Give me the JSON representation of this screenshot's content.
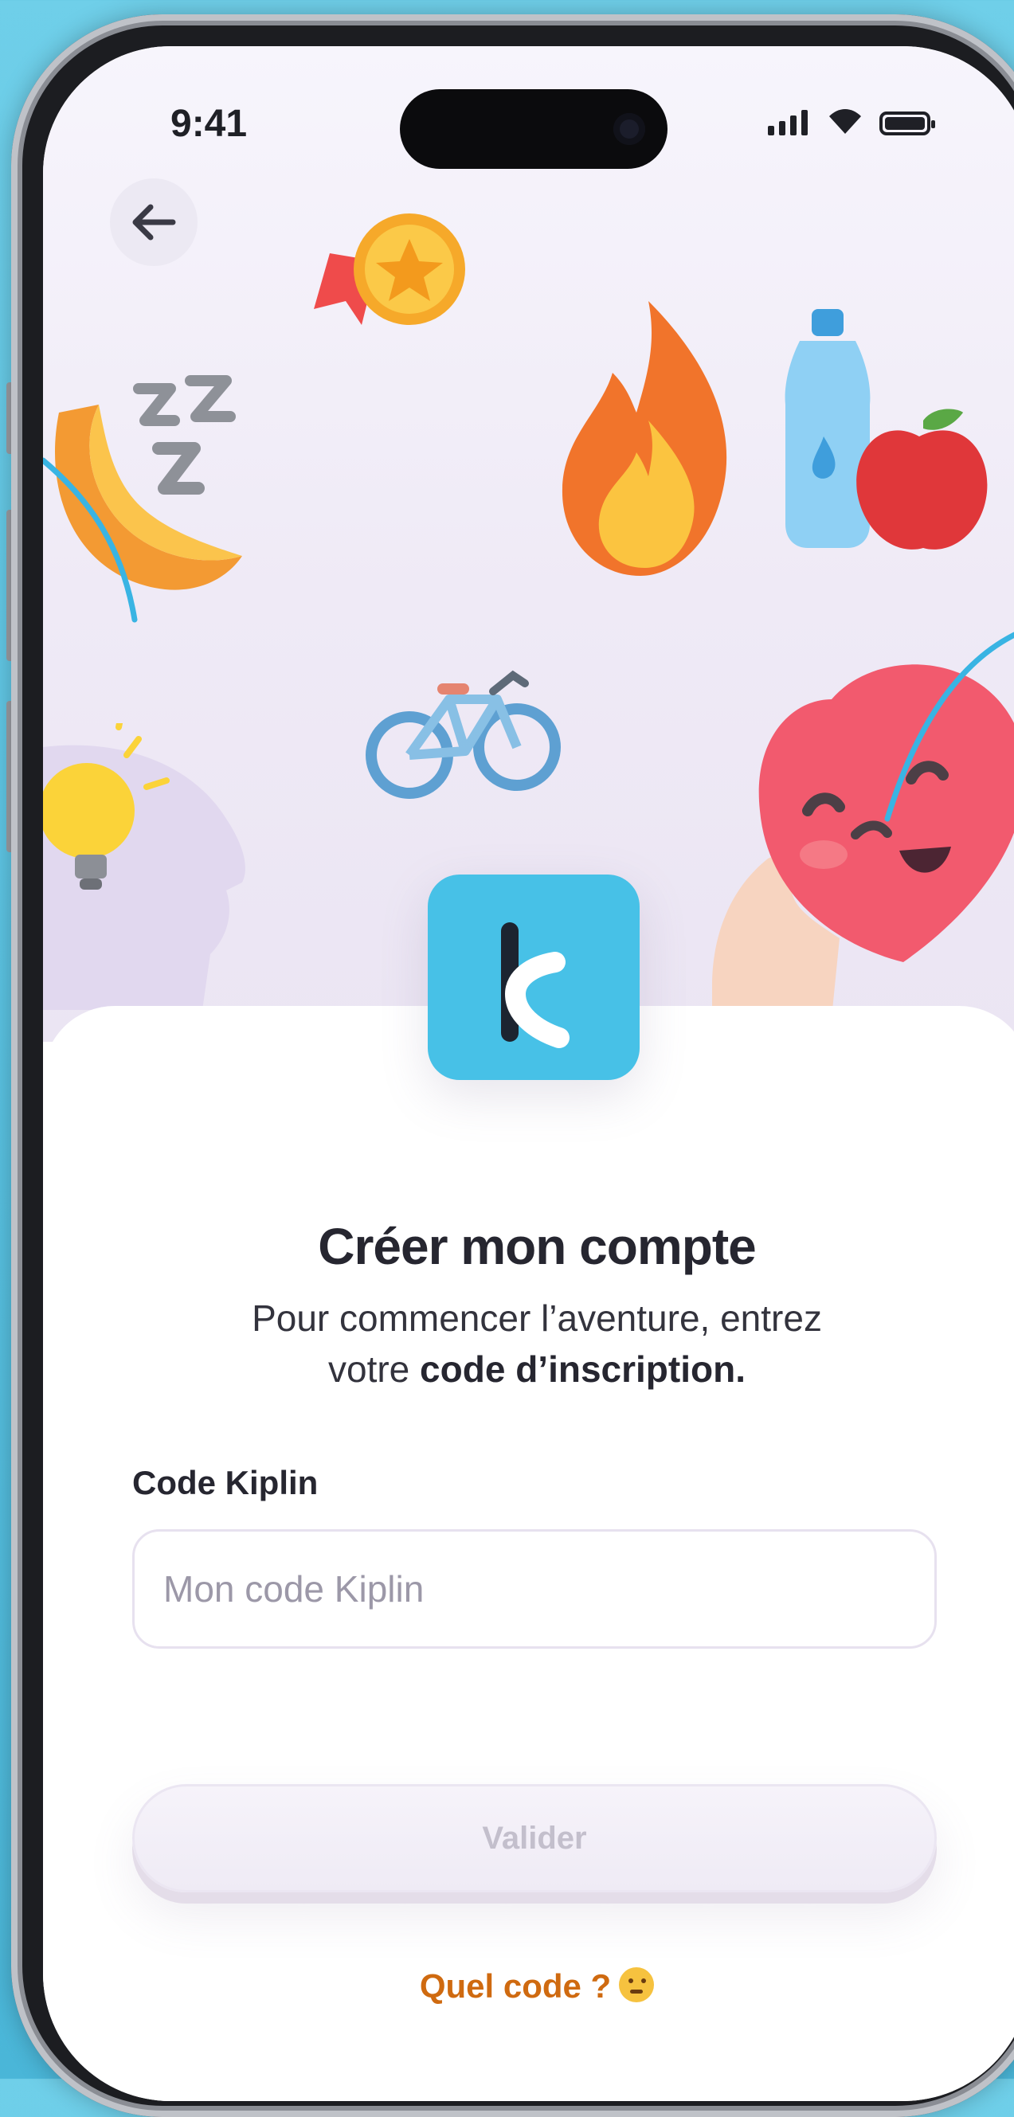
{
  "status_bar": {
    "time": "9:41"
  },
  "header": {
    "back_label": "←"
  },
  "logo": {
    "letter": "k"
  },
  "signup": {
    "title": "Créer mon compte",
    "subtitle_plain": "Pour commencer l’aventure, entrez votre ",
    "subtitle_bold": "code d’inscription."
  },
  "form": {
    "code_label": "Code Kiplin",
    "code_placeholder": "Mon code Kiplin",
    "code_value": "",
    "submit_label": "Valider"
  },
  "help": {
    "link_label": "Quel code ?"
  },
  "colors": {
    "brand": "#47c1e7",
    "link": "#cf6a10",
    "text": "#262630",
    "disabled": "#c3bfcc"
  },
  "icons": [
    "back-arrow-icon",
    "signal-icon",
    "wifi-icon",
    "battery-icon",
    "medal-icon",
    "flame-icon",
    "water-bottle-icon",
    "apple-icon",
    "moon-icon",
    "sleep-zzz-icon",
    "bicycle-icon",
    "lightbulb-head-icon",
    "heart-character-icon",
    "thinking-face-icon"
  ]
}
